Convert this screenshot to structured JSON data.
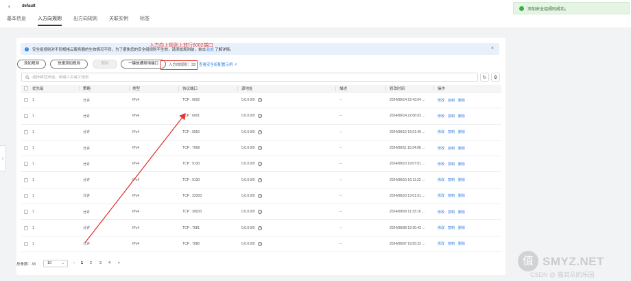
{
  "header": {
    "instance_name": "default",
    "tabs": [
      "基本信息",
      "入方向规则",
      "出方向规则",
      "关联实例",
      "标签"
    ],
    "active_tab": "入方向规则"
  },
  "toast": {
    "text": "添加安全组规则成功。",
    "color": "#3cb043"
  },
  "info": {
    "text_before": "安全组规则对不同规格云服务器的生效情况不同，为了避免您的安全组规则不生效，请添加规则前，单击",
    "link": "此处",
    "text_after": "了解详情。",
    "close": "×"
  },
  "toolbar": {
    "add_rule": "添加规则",
    "fast_add": "快速添加规则",
    "delete": "删除",
    "open_common": "一键放通常用端口",
    "quota": "入方向规则：33",
    "quota_link": "查看安全组配置示例"
  },
  "search": {
    "placeholder": "选择属性筛选，或输入关键字搜索"
  },
  "table": {
    "headers": [
      "优先级",
      "策略",
      "类型",
      "协议端口",
      "源地址",
      "描述",
      "修改时间",
      "操作"
    ],
    "actions": [
      "修改",
      "复制",
      "删除"
    ],
    "rows": [
      {
        "priority": "1",
        "policy": "允许",
        "type": "IPv4",
        "port": "TCP : 6002",
        "source": "0.0.0.0/0",
        "desc": "--",
        "time": "2024/08/14 22:43:04 ..."
      },
      {
        "priority": "1",
        "policy": "允许",
        "type": "IPv4",
        "port": "TCP : 6001",
        "source": "0.0.0.0/0",
        "desc": "--",
        "time": "2024/08/14 22:06:03 ..."
      },
      {
        "priority": "1",
        "policy": "允许",
        "type": "IPv4",
        "port": "TCP : 5550",
        "source": "0.0.0.0/0",
        "desc": "--",
        "time": "2024/08/12 16:01:49 ..."
      },
      {
        "priority": "1",
        "policy": "允许",
        "type": "IPv4",
        "port": "TCP : 7668",
        "source": "0.0.0.0/0",
        "desc": "--",
        "time": "2024/08/11 15:24:08 ..."
      },
      {
        "priority": "1",
        "policy": "允许",
        "type": "IPv4",
        "port": "TCP : 9130",
        "source": "0.0.0.0/0",
        "desc": "--",
        "time": "2024/08/10 19:07:01 ..."
      },
      {
        "priority": "1",
        "policy": "允许",
        "type": "IPv4",
        "port": "TCP : 9130",
        "source": "0.0.0.0/0",
        "desc": "--",
        "time": "2024/08/10 16:11:22 ..."
      },
      {
        "priority": "1",
        "policy": "允许",
        "type": "IPv4",
        "port": "TCP : 22303",
        "source": "0.0.0.0/0",
        "desc": "--",
        "time": "2024/08/10 13:01:51 ..."
      },
      {
        "priority": "1",
        "policy": "允许",
        "type": "IPv4",
        "port": "TCP : 30033",
        "source": "0.0.0.0/0",
        "desc": "--",
        "time": "2024/08/09 11:33:16 ..."
      },
      {
        "priority": "1",
        "policy": "允许",
        "type": "IPv4",
        "port": "TCP : 7681",
        "source": "0.0.0.0/0",
        "desc": "--",
        "time": "2024/08/08 12:30:43 ..."
      },
      {
        "priority": "1",
        "policy": "允许",
        "type": "IPv4",
        "port": "TCP : 7680",
        "source": "0.0.0.0/0",
        "desc": "--",
        "time": "2024/08/07 19:55:22 ..."
      }
    ]
  },
  "pager": {
    "total": "总条数：33",
    "page_size": "10",
    "prev": "<",
    "pages": [
      "1",
      "2",
      "3",
      "4"
    ],
    "next": ">"
  },
  "annotation": {
    "text": "入方向上规则上放行6002端口",
    "color": "#e53935"
  },
  "watermark": {
    "logo": "值",
    "text": "SMYZ.NET",
    "sub": "CSDN @ 猫耳朵的乐园"
  }
}
